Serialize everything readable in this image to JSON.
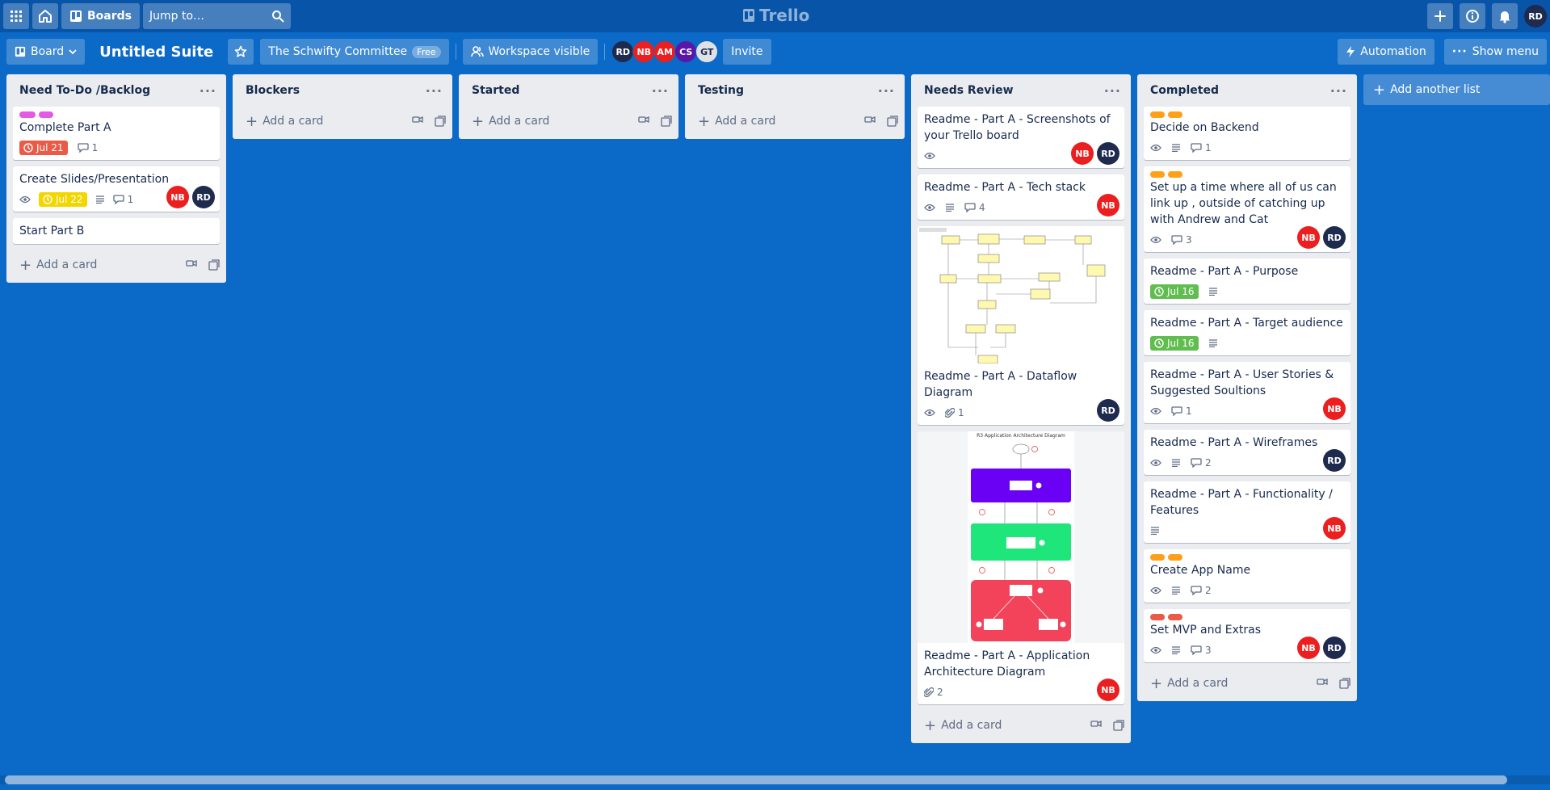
{
  "topbar": {
    "boards_label": "Boards",
    "search_placeholder": "Jump to…",
    "logo_text": "Trello",
    "user_initials": "RD"
  },
  "boardbar": {
    "view_label": "Board",
    "board_title": "Untitled Suite",
    "workspace_name": "The Schwifty Committee",
    "workspace_plan": "Free",
    "visibility_label": "Workspace visible",
    "members": [
      "RD",
      "NB",
      "AM",
      "CS",
      "GT"
    ],
    "invite_label": "Invite",
    "automation_label": "Automation",
    "show_menu_label": "Show menu"
  },
  "lists": [
    {
      "title": "Need To-Do /Backlog",
      "cards": [
        {
          "title": "Complete Part A",
          "labels": [
            "#e45ae4",
            "#e45ae4"
          ],
          "date": "Jul 21",
          "date_status": "red",
          "comments": "1",
          "watch": false,
          "desc": false,
          "members": []
        },
        {
          "title": "Create Slides/Presentation",
          "date": "Jul 22",
          "date_status": "yellow",
          "comments": "1",
          "watch": true,
          "desc": true,
          "members": [
            "NB",
            "RD"
          ]
        },
        {
          "title": "Start Part B",
          "members": []
        }
      ],
      "add_label": "Add a card"
    },
    {
      "title": "Blockers",
      "cards": [],
      "add_label": "Add a card"
    },
    {
      "title": "Started",
      "cards": [],
      "add_label": "Add a card"
    },
    {
      "title": "Testing",
      "cards": [],
      "add_label": "Add a card"
    },
    {
      "title": "Needs Review",
      "cards": [
        {
          "title": "Readme - Part A - Screenshots of your Trello board",
          "watch": true,
          "members": [
            "NB",
            "RD"
          ]
        },
        {
          "title": "Readme - Part A - Tech stack",
          "watch": true,
          "desc": true,
          "comments": "4",
          "members": [
            "NB"
          ]
        },
        {
          "title": "Readme - Part A - Dataflow Diagram",
          "watch": true,
          "attachments": "1",
          "members": [
            "RD"
          ],
          "image": "dataflow"
        },
        {
          "title": "Readme - Part A - Application Architecture Diagram",
          "attachments": "2",
          "members": [
            "NB"
          ],
          "image": "architecture",
          "image_caption": "R3 Application Architecture Diagram"
        }
      ],
      "add_label": "Add a card"
    },
    {
      "title": "Completed",
      "cards": [
        {
          "title": "Decide on Backend",
          "labels": [
            "#ff9f1a",
            "#ff9f1a"
          ],
          "watch": true,
          "desc": true,
          "comments": "1",
          "members": []
        },
        {
          "title": "Set up a time where all of us can link up , outside of catching up with Andrew and Cat",
          "labels": [
            "#ff9f1a",
            "#ff9f1a"
          ],
          "watch": true,
          "comments": "3",
          "members": [
            "NB",
            "RD"
          ]
        },
        {
          "title": "Readme - Part A - Purpose",
          "date": "Jul 16",
          "date_status": "green",
          "desc": true,
          "members": []
        },
        {
          "title": "Readme - Part A - Target audience",
          "date": "Jul 16",
          "date_status": "green",
          "desc": true,
          "members": []
        },
        {
          "title": "Readme - Part A - User Stories & Suggested Soultions",
          "watch": true,
          "comments": "1",
          "members": [
            "NB"
          ]
        },
        {
          "title": "Readme - Part A - Wireframes",
          "watch": true,
          "desc": true,
          "comments": "2",
          "members": [
            "RD"
          ]
        },
        {
          "title": "Readme - Part A - Functionality / Features",
          "desc": true,
          "members": [
            "NB"
          ]
        },
        {
          "title": "Create App Name",
          "labels": [
            "#ff9f1a",
            "#ff9f1a"
          ],
          "watch": true,
          "desc": true,
          "comments": "2",
          "members": []
        },
        {
          "title": "Set MVP and Extras",
          "labels": [
            "#eb5a46",
            "#eb5a46"
          ],
          "watch": true,
          "desc": true,
          "comments": "3",
          "members": [
            "NB",
            "RD"
          ]
        }
      ],
      "add_label": "Add a card"
    }
  ],
  "add_list_label": "Add another list",
  "colors": {
    "background": "#0b69c7",
    "topbar": "#0754a8",
    "list_bg": "#ebecf0",
    "date_red": "#eb5a46",
    "date_yellow": "#f2d600",
    "date_green": "#61bd4f"
  }
}
